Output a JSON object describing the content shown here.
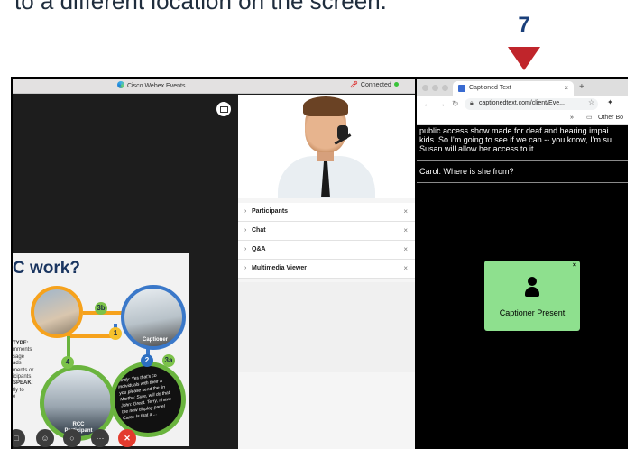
{
  "instruction": {
    "partial_text": "to a different location on the screen.",
    "step_number": "7",
    "colors": {
      "step_number": "#1a3f7a",
      "arrow": "#c0252b"
    }
  },
  "webex": {
    "title": "Cisco Webex Events",
    "status": "Connected",
    "slide": {
      "title": "C work?",
      "side_text": {
        "type_heading": "TYPE:",
        "type_lines": [
          "mments",
          "sage",
          "ads",
          "ments or",
          "icipants."
        ],
        "speak_heading": "SPEAK:",
        "speak_lines": [
          "tly to",
          "e"
        ]
      },
      "badges": [
        "3b",
        "1",
        "4",
        "2",
        "3a"
      ],
      "circle_labels": {
        "captioner": "Captioner",
        "rcc_line1": "RCC",
        "rcc_line2": "Participant"
      },
      "caption_sample": [
        "Cindy: Yes that's co",
        "individuals with their a",
        "you please send the lin",
        "Martha: Sure, will do that",
        "John: Great. Terry, I have",
        "the new display panel",
        "Carol: Is that a ..."
      ]
    },
    "panels": [
      {
        "label": "Participants"
      },
      {
        "label": "Chat"
      },
      {
        "label": "Q&A"
      },
      {
        "label": "Multimedia Viewer"
      }
    ],
    "controls": [
      "mute",
      "participants",
      "chat",
      "more",
      "end"
    ]
  },
  "browser": {
    "tab_title": "Captioned Text",
    "url": "captionedtext.com/client/Eve...",
    "bookmarks_more": "»",
    "bookmarks_other": "Other Bo",
    "captions": {
      "lines": [
        "public access show made for deaf and hearing impai",
        "kids. So I'm going to see if we can -- you know, I'm su",
        "Susan will allow her access to it."
      ],
      "carol": "Carol: Where is she from?"
    },
    "captioner_popup": {
      "label": "Captioner Present",
      "color": "#8ee08e"
    }
  }
}
